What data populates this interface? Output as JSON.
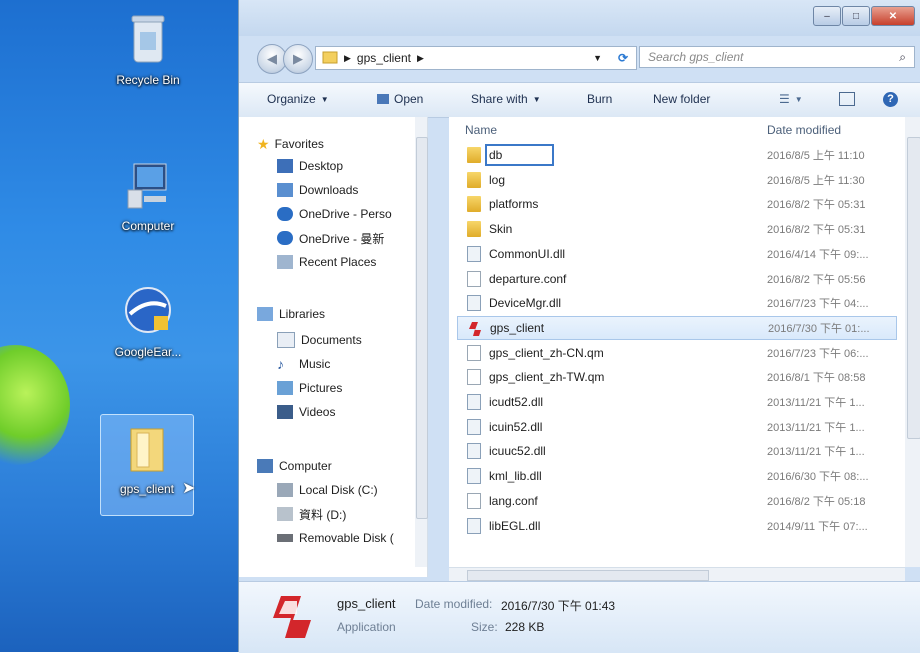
{
  "desktop": {
    "icons": [
      {
        "label": "Recycle Bin"
      },
      {
        "label": "Computer"
      },
      {
        "label": "GoogleEar..."
      },
      {
        "label": "gps_client"
      }
    ]
  },
  "window": {
    "address": {
      "segment": "gps_client"
    },
    "search_placeholder": "Search gps_client",
    "toolbar": {
      "organize": "Organize",
      "open": "Open",
      "share_with": "Share with",
      "burn": "Burn",
      "new_folder": "New folder"
    },
    "nav": {
      "favorites": "Favorites",
      "favorites_items": [
        "Desktop",
        "Downloads",
        "OneDrive - Perso",
        "OneDrive - 曼新",
        "Recent Places"
      ],
      "libraries": "Libraries",
      "libraries_items": [
        "Documents",
        "Music",
        "Pictures",
        "Videos"
      ],
      "computer": "Computer",
      "computer_items": [
        "Local Disk (C:)",
        "資料 (D:)",
        "Removable Disk ("
      ]
    },
    "columns": {
      "name": "Name",
      "date_modified": "Date modified"
    },
    "files": [
      {
        "name": "db",
        "date": "2016/8/5 上午 11:10",
        "type": "folder"
      },
      {
        "name": "log",
        "date": "2016/8/5 上午 11:30",
        "type": "folder"
      },
      {
        "name": "platforms",
        "date": "2016/8/2 下午 05:31",
        "type": "folder"
      },
      {
        "name": "Skin",
        "date": "2016/8/2 下午 05:31",
        "type": "folder"
      },
      {
        "name": "CommonUI.dll",
        "date": "2016/4/14 下午 09:...",
        "type": "dll"
      },
      {
        "name": "departure.conf",
        "date": "2016/8/2 下午 05:56",
        "type": "file"
      },
      {
        "name": "DeviceMgr.dll",
        "date": "2016/7/23 下午 04:...",
        "type": "dll"
      },
      {
        "name": "gps_client",
        "date": "2016/7/30 下午 01:...",
        "type": "app"
      },
      {
        "name": "gps_client_zh-CN.qm",
        "date": "2016/7/23 下午 06:...",
        "type": "file"
      },
      {
        "name": "gps_client_zh-TW.qm",
        "date": "2016/8/1 下午 08:58",
        "type": "file"
      },
      {
        "name": "icudt52.dll",
        "date": "2013/11/21 下午 1...",
        "type": "dll"
      },
      {
        "name": "icuin52.dll",
        "date": "2013/11/21 下午 1...",
        "type": "dll"
      },
      {
        "name": "icuuc52.dll",
        "date": "2013/11/21 下午 1...",
        "type": "dll"
      },
      {
        "name": "kml_lib.dll",
        "date": "2016/6/30 下午 08:...",
        "type": "dll"
      },
      {
        "name": "lang.conf",
        "date": "2016/8/2 下午 05:18",
        "type": "file"
      },
      {
        "name": "libEGL.dll",
        "date": "2014/9/11 下午 07:...",
        "type": "dll"
      }
    ],
    "details": {
      "name": "gps_client",
      "type": "Application",
      "date_label": "Date modified:",
      "date_value": "2016/7/30 下午 01:43",
      "size_label": "Size:",
      "size_value": "228 KB"
    }
  },
  "colors": {
    "accent": "#3b78c8",
    "desktop": "#2f8be6",
    "app_icon": "#d3262b"
  }
}
